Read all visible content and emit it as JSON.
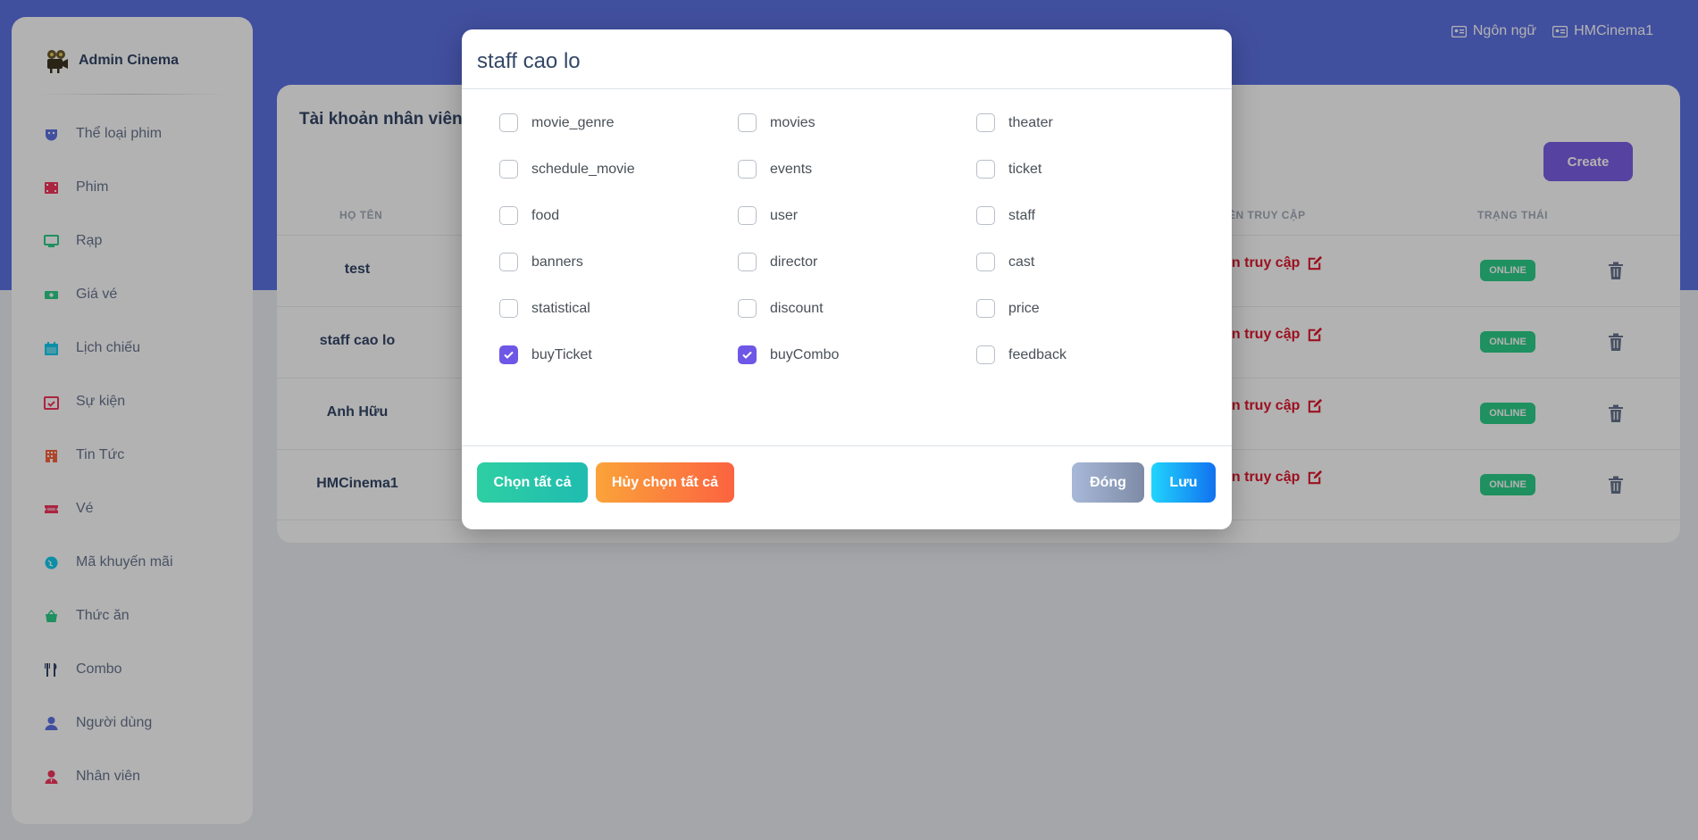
{
  "topnav": {
    "language": "Ngôn ngữ",
    "user": "HMCinema1"
  },
  "sidebar": {
    "brand": "Admin Cinema",
    "items": [
      {
        "label": "Thể loại phim",
        "icon": "masks-icon",
        "color": "#5e72e4"
      },
      {
        "label": "Phim",
        "icon": "film-icon",
        "color": "#f5365c"
      },
      {
        "label": "Rạp",
        "icon": "monitor-icon",
        "color": "#2dce89"
      },
      {
        "label": "Giá vé",
        "icon": "money-icon",
        "color": "#2dce89"
      },
      {
        "label": "Lịch chiếu",
        "icon": "calendar-icon",
        "color": "#11cdef"
      },
      {
        "label": "Sự kiện",
        "icon": "calendar-check-icon",
        "color": "#f5365c"
      },
      {
        "label": "Tin Tức",
        "icon": "building-icon",
        "color": "#fb6340"
      },
      {
        "label": "Vé",
        "icon": "ticket-icon",
        "color": "#f5365c"
      },
      {
        "label": "Mã khuyến mãi",
        "icon": "globe-icon",
        "color": "#11cdef"
      },
      {
        "label": "Thức ăn",
        "icon": "basket-icon",
        "color": "#2dce89"
      },
      {
        "label": "Combo",
        "icon": "utensils-icon",
        "color": "#344767"
      },
      {
        "label": "Người dùng",
        "icon": "user-icon",
        "color": "#5e72e4"
      },
      {
        "label": "Nhân viên",
        "icon": "user-tie-icon",
        "color": "#f5365c"
      }
    ]
  },
  "page": {
    "title": "Tài khoản nhân viên",
    "create_label": "Create",
    "columns": {
      "name": "HỌ TÊN",
      "access": "ỀN TRUY CẬP",
      "status": "TRẠNG THÁI"
    },
    "rows": [
      {
        "name": "test",
        "access": "ền truy cập",
        "status": "ONLINE"
      },
      {
        "name": "staff cao lo",
        "access": "ền truy cập",
        "status": "ONLINE"
      },
      {
        "name": "Anh Hữu",
        "access": "ền truy cập",
        "status": "ONLINE"
      },
      {
        "name": "HMCinema1",
        "access": "ền truy cập",
        "status": "ONLINE"
      }
    ]
  },
  "modal": {
    "title": "staff cao lo",
    "permissions": [
      {
        "label": "movie_genre",
        "checked": false
      },
      {
        "label": "movies",
        "checked": false
      },
      {
        "label": "theater",
        "checked": false
      },
      {
        "label": "schedule_movie",
        "checked": false
      },
      {
        "label": "events",
        "checked": false
      },
      {
        "label": "ticket",
        "checked": false
      },
      {
        "label": "food",
        "checked": false
      },
      {
        "label": "user",
        "checked": false
      },
      {
        "label": "staff",
        "checked": false
      },
      {
        "label": "banners",
        "checked": false
      },
      {
        "label": "director",
        "checked": false
      },
      {
        "label": "cast",
        "checked": false
      },
      {
        "label": "statistical",
        "checked": false
      },
      {
        "label": "discount",
        "checked": false
      },
      {
        "label": "price",
        "checked": false
      },
      {
        "label": "buyTicket",
        "checked": true
      },
      {
        "label": "buyCombo",
        "checked": true
      },
      {
        "label": "feedback",
        "checked": false
      }
    ],
    "select_all_label": "Chọn tất cả",
    "deselect_all_label": "Hủy chọn tất cả",
    "close_label": "Đóng",
    "save_label": "Lưu"
  },
  "colors": {
    "header_blue": "#5e72e4",
    "create_purple": "#7b5fe6",
    "online_green": "#2dce89",
    "link_red": "#e0182d",
    "checkbox_purple": "#6e57e6"
  }
}
